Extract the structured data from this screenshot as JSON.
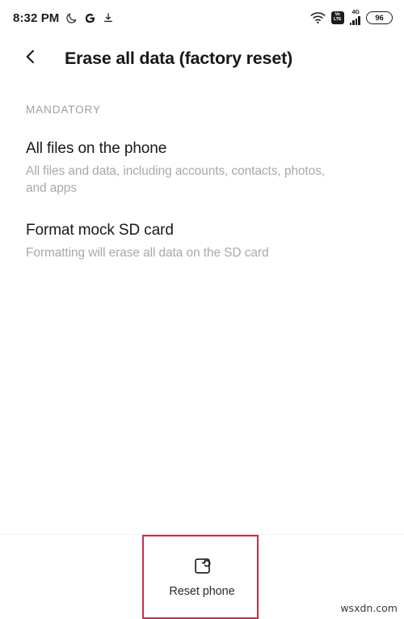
{
  "status_bar": {
    "clock": "8:32 PM",
    "left_icons": [
      {
        "name": "dnd-moon-icon",
        "glyph": "☾"
      },
      {
        "name": "google-g-icon",
        "glyph": "G"
      },
      {
        "name": "download-icon",
        "glyph": "⬇"
      }
    ],
    "wifi_icon": "wifi-icon",
    "volte_line1": "Vo",
    "volte_line2": "LTE",
    "network_generation": "4G",
    "signal_icon": "signal-bars-icon",
    "battery_level": "96"
  },
  "app_bar": {
    "back_icon": "chevron-left-icon",
    "title": "Erase all data (factory reset)"
  },
  "content": {
    "section_label": "MANDATORY",
    "items": [
      {
        "title": "All files on the phone",
        "description": "All files and data, including accounts, contacts, photos, and apps"
      },
      {
        "title": "Format mock SD card",
        "description": "Formatting will erase all data on the SD card"
      }
    ]
  },
  "bottom_bar": {
    "reset_icon": "reset-phone-icon",
    "reset_label": "Reset phone"
  },
  "highlight": {
    "color": "#c0304a"
  },
  "watermark": {
    "text": "wsxdn.com"
  }
}
